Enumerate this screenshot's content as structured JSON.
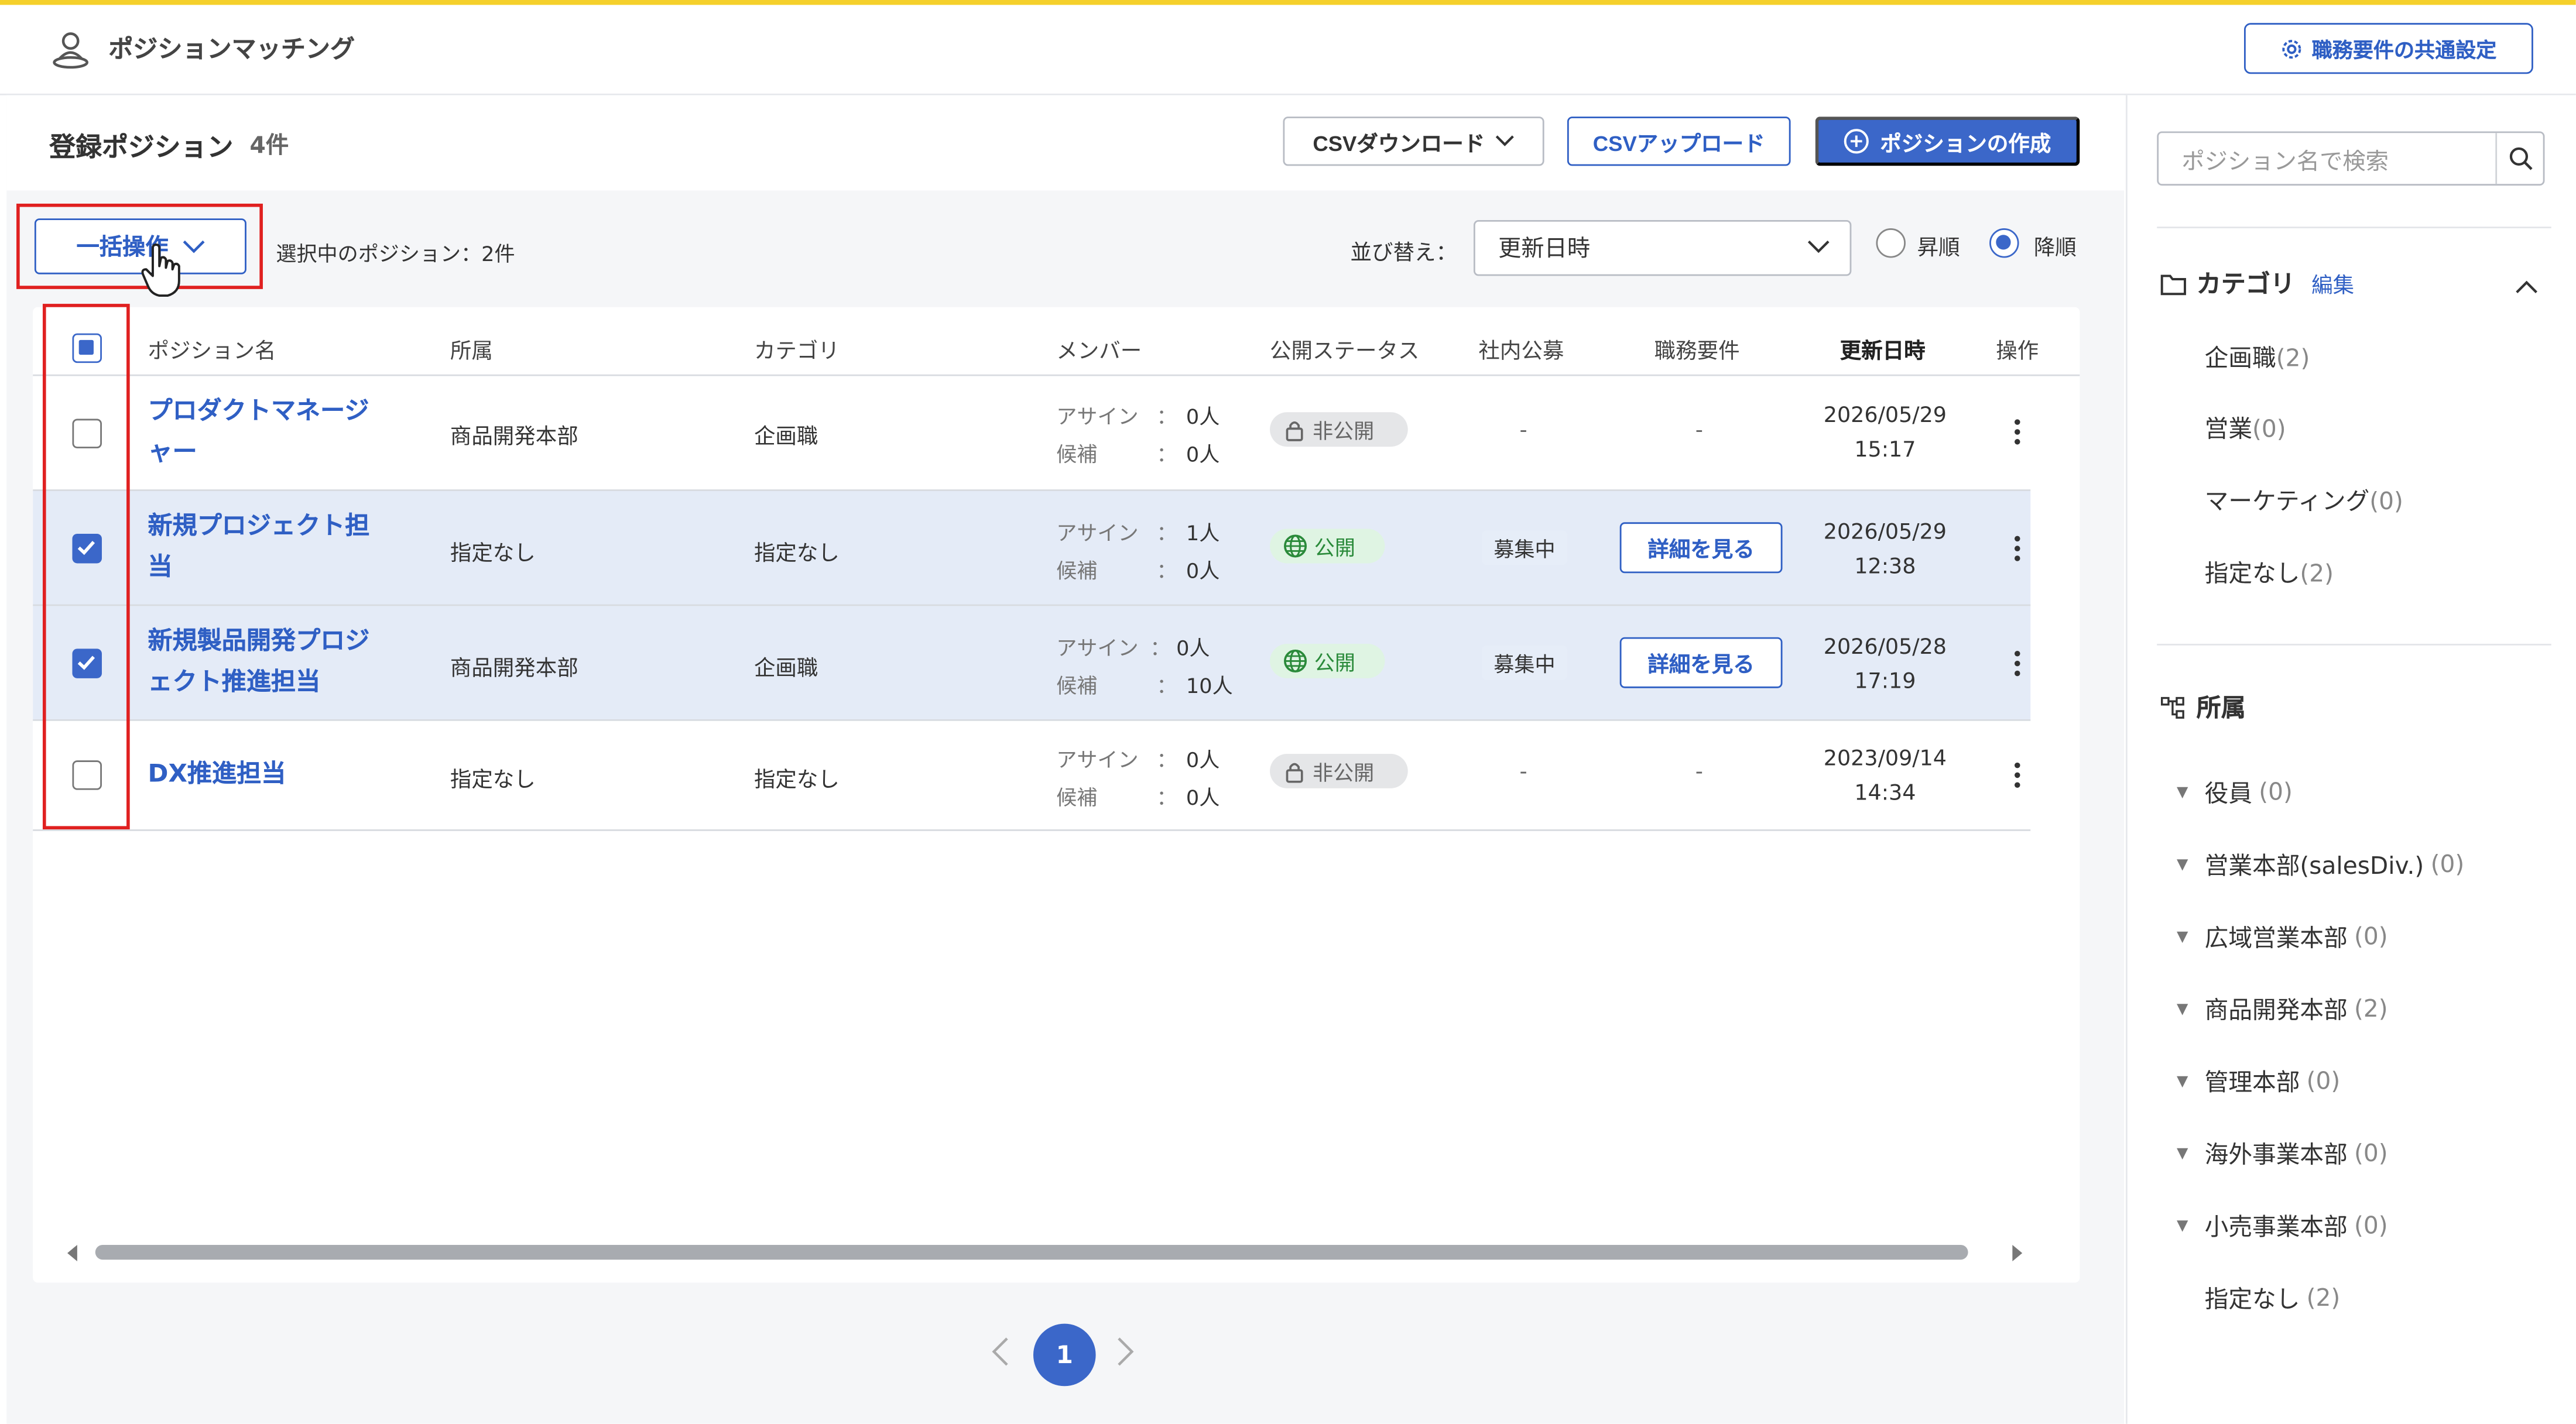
{
  "header": {
    "app_title": "ポジションマッチング",
    "common_settings_label": "職務要件の共通設定"
  },
  "toolbar": {
    "page_title": "登録ポジション",
    "count": "4件",
    "csv_download": "CSVダウンロード",
    "csv_upload": "CSVアップロード",
    "create_position": "ポジションの作成",
    "bulk_action": "一括操作",
    "selected_info": "選択中のポジション：2件",
    "sort_label": "並び替え：",
    "sort_value": "更新日時",
    "asc_label": "昇順",
    "desc_label": "降順",
    "order": "desc"
  },
  "table": {
    "columns": [
      "ポジション名",
      "所属",
      "カテゴリ",
      "メンバー",
      "公開ステータス",
      "社内公募",
      "職務要件",
      "更新日時",
      "操作"
    ],
    "assign_label": "アサイン",
    "candidate_label": "候補",
    "rows": [
      {
        "name": "プロダクトマネージャー",
        "name_line1": "プロダクトマネージ",
        "name_line2": "ャー",
        "dept": "商品開発本部",
        "category": "企画職",
        "assign": "0人",
        "candidate": "0人",
        "status": "非公開",
        "recruit": "-",
        "requirement": "-",
        "date": "2026/05/29",
        "time": "15:17",
        "selected": false
      },
      {
        "name": "新規プロジェクト担当",
        "name_line1": "新規プロジェクト担",
        "name_line2": "当",
        "dept": "指定なし",
        "category": "指定なし",
        "assign": "1人",
        "candidate": "0人",
        "status": "公開",
        "recruit": "募集中",
        "requirement": "詳細を見る",
        "date": "2026/05/29",
        "time": "12:38",
        "selected": true
      },
      {
        "name": "新規製品開発プロジェクト推進担当",
        "name_line1": "新規製品開発プロジ",
        "name_line2": "ェクト推進担当",
        "dept": "商品開発本部",
        "category": "企画職",
        "assign": "0人",
        "candidate": "10人",
        "status": "公開",
        "recruit": "募集中",
        "requirement": "詳細を見る",
        "date": "2026/05/28",
        "time": "17:19",
        "selected": true
      },
      {
        "name": "DX推進担当",
        "name_line1": "DX推進担当",
        "name_line2": "",
        "dept": "指定なし",
        "category": "指定なし",
        "assign": "0人",
        "candidate": "0人",
        "status": "非公開",
        "recruit": "-",
        "requirement": "-",
        "date": "2023/09/14",
        "time": "14:34",
        "selected": false
      }
    ]
  },
  "pagination": {
    "current": "1"
  },
  "sidebar": {
    "search_placeholder": "ポジション名で検索",
    "category_title": "カテゴリ",
    "category_edit": "編集",
    "categories": [
      {
        "label": "企画職",
        "count": "(2)"
      },
      {
        "label": "営業",
        "count": "(0)"
      },
      {
        "label": "マーケティング",
        "count": "(0)"
      },
      {
        "label": "指定なし",
        "count": "(2)"
      }
    ],
    "org_title": "所属",
    "orgs": [
      {
        "label": "役員",
        "count": "(0)",
        "expand": true
      },
      {
        "label": "営業本部(salesDiv.)",
        "count": "(0)",
        "expand": true
      },
      {
        "label": "広域営業本部",
        "count": "(0)",
        "expand": true
      },
      {
        "label": "商品開発本部",
        "count": "(2)",
        "expand": true
      },
      {
        "label": "管理本部",
        "count": "(0)",
        "expand": true
      },
      {
        "label": "海外事業本部",
        "count": "(0)",
        "expand": true
      },
      {
        "label": "小売事業本部",
        "count": "(0)",
        "expand": true
      },
      {
        "label": "指定なし",
        "count": "(2)",
        "expand": false
      }
    ]
  },
  "colors": {
    "accent": "#3b67c9",
    "link": "#2f5fc4",
    "highlight": "#e02020",
    "top_bar": "#f5d02b",
    "public_green": "#2a8a3a"
  }
}
